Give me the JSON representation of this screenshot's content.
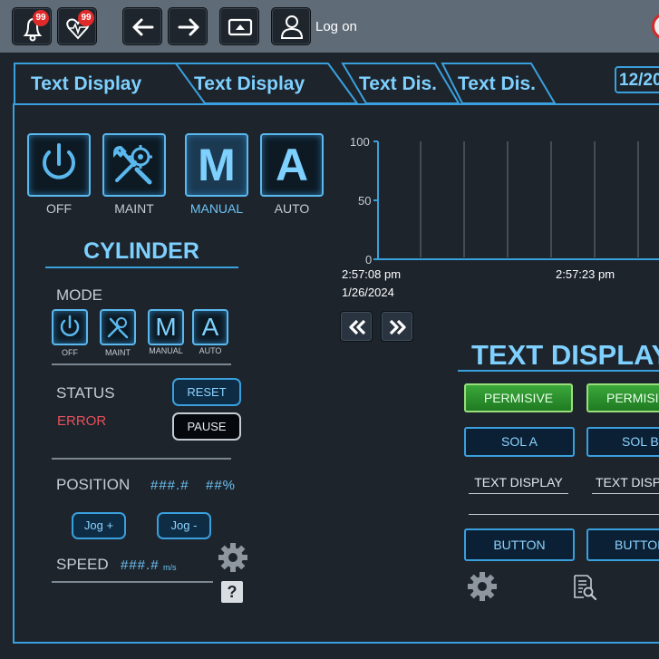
{
  "topbar": {
    "alarm_badge": "99",
    "health_badge": "99",
    "logon_label": "Log on",
    "icons": [
      "bell-icon",
      "heart-monitor-icon",
      "arrow-left-icon",
      "arrow-right-icon",
      "screen-icon",
      "user-icon"
    ]
  },
  "tabs": [
    {
      "label": "Text Display"
    },
    {
      "label": "Text Display"
    },
    {
      "label": "Text Dis."
    },
    {
      "label": "Text Dis."
    }
  ],
  "date_display": "12/20",
  "main_modes": [
    {
      "label": "OFF",
      "icon": "power-icon"
    },
    {
      "label": "MAINT",
      "icon": "wrench-gear-icon"
    },
    {
      "label": "MANUAL",
      "glyph": "M",
      "active": true
    },
    {
      "label": "AUTO",
      "glyph": "A"
    }
  ],
  "cylinder": {
    "title": "CYLINDER",
    "mode_label": "MODE",
    "modes": [
      {
        "label": "OFF",
        "icon": "power-icon"
      },
      {
        "label": "MAINT",
        "icon": "wrench-gear-icon"
      },
      {
        "label": "MANUAL",
        "glyph": "M"
      },
      {
        "label": "AUTO",
        "glyph": "A"
      }
    ],
    "status_label": "STATUS",
    "status_value": "ERROR",
    "reset_label": "RESET",
    "pause_label": "PAUSE",
    "position_label": "POSITION",
    "position_value": "###.#",
    "position_pct": "##%",
    "jog_plus": "Jog +",
    "jog_minus": "Jog -",
    "speed_label": "SPEED",
    "speed_value": "###.#",
    "speed_unit": "m/s",
    "help_glyph": "?"
  },
  "chart_data": {
    "type": "line",
    "y_ticks": [
      "100",
      "50",
      "0"
    ],
    "ylim": [
      0,
      100
    ],
    "x_start_time": "2:57:08 pm",
    "x_start_date": "1/26/2024",
    "x_mid_time": "2:57:23 pm",
    "series": []
  },
  "text_display_panel": {
    "title": "TEXT DISPLAY",
    "permissive_1": "PERMISIVE",
    "permissive_2": "PERMISIVE",
    "sol_a": "SOL A",
    "sol_b": "SOL B",
    "text_1": "TEXT DISPLAY",
    "text_2": "TEXT DISPLAY",
    "button_1": "BUTTON",
    "button_2": "BUTTON"
  },
  "colors": {
    "accent": "#3aa0dd",
    "text_blue": "#7ed0ff",
    "error": "#e8505b",
    "green": "#2e9a30"
  }
}
